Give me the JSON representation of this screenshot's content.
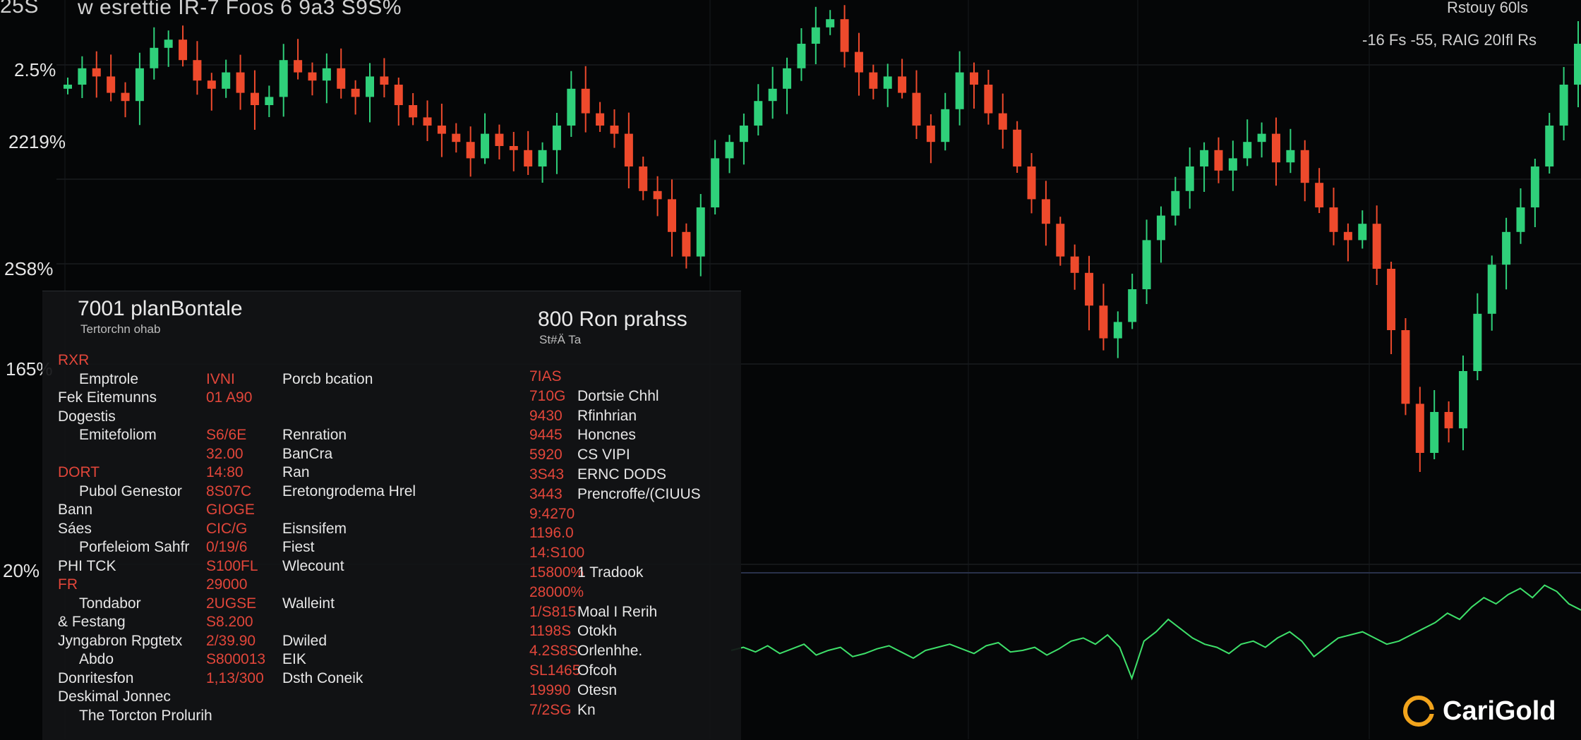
{
  "colors": {
    "up": "#2fd07a",
    "down": "#ee4a2c",
    "panel": "#121416",
    "logo_accent": "#f2a41c"
  },
  "header": {
    "top_left": "25S",
    "title": "w esrettie IR-7 Foos 6 9a3 S9S%",
    "top_right_1": "Rstouy 60ls",
    "top_right_2": "-16 Fs -55, RAIG 20Ifl Rs"
  },
  "y_axis_labels": [
    "2.5%",
    "2219%",
    "2S8%",
    "165%",
    "20%"
  ],
  "chart_data": {
    "type": "candlestick",
    "title": "w esrettie IR-7 Foos 6 9a3 S9S%",
    "y_tick_labels": [
      "2.5%",
      "2219%",
      "2S8%",
      "165%",
      "20%"
    ],
    "close_series": [
      100,
      104,
      102,
      98,
      96,
      104,
      109,
      111,
      106,
      101,
      99,
      103,
      98,
      95,
      97,
      106,
      103,
      101,
      104,
      99,
      97,
      102,
      100,
      95,
      92,
      90,
      88,
      86,
      82,
      88,
      85,
      84,
      80,
      84,
      90,
      99,
      93,
      90,
      88,
      80,
      74,
      72,
      64,
      58,
      70,
      82,
      86,
      90,
      96,
      99,
      104,
      110,
      114,
      116,
      108,
      103,
      99,
      102,
      98,
      90,
      86,
      94,
      103,
      100,
      93,
      89,
      80,
      72,
      66,
      58,
      54,
      46,
      38,
      42,
      50,
      62,
      68,
      74,
      80,
      84,
      79,
      82,
      86,
      88,
      81,
      84,
      76,
      70,
      64,
      62,
      66,
      55,
      40,
      22,
      10,
      20,
      16,
      30,
      44,
      56,
      64,
      70,
      80,
      90,
      100,
      110
    ],
    "oscillator": [
      0,
      2,
      -1,
      3,
      -2,
      1,
      4,
      -3,
      0,
      2,
      -4,
      -2,
      1,
      3,
      -1,
      -5,
      0,
      2,
      4,
      1,
      -2,
      3,
      5,
      -1,
      0,
      2,
      -3,
      1,
      6,
      8,
      4,
      10,
      2,
      -18,
      6,
      12,
      20,
      14,
      8,
      4,
      2,
      -2,
      4,
      6,
      2,
      8,
      12,
      6,
      -4,
      2,
      8,
      10,
      12,
      8,
      4,
      6,
      10,
      14,
      18,
      24,
      20,
      28,
      34,
      30,
      36,
      40,
      34,
      42,
      38,
      30,
      26
    ]
  },
  "panel_left": {
    "title": "7001 planBontale",
    "subtitle": "Tertorchn ohab",
    "rows": [
      {
        "left": "RXR",
        "left_red": true,
        "mid": "",
        "right": ""
      },
      {
        "left": "Emptrole",
        "left_red": false,
        "mid": "IVNI",
        "right": "Porcb bcation"
      },
      {
        "left": "Fek Eitemunns",
        "left_red": false,
        "mid": "01 A90",
        "right": ""
      },
      {
        "left": "Dogestis",
        "left_red": false,
        "mid": "",
        "right": ""
      },
      {
        "left": "Emitefoliom",
        "left_red": false,
        "mid": "S6/6E",
        "right": "Renration"
      },
      {
        "left": "",
        "left_red": false,
        "mid": "32.00",
        "right": "BanCra"
      },
      {
        "left": "DORT",
        "left_red": true,
        "mid": "14:80",
        "right": "Ran"
      },
      {
        "left": "Pubol Genestor",
        "left_red": false,
        "mid": "8S07C",
        "right": "Eretongrodema Hrel"
      },
      {
        "left": "Bann",
        "left_red": false,
        "mid": "GIOGE",
        "right": ""
      },
      {
        "left": "Sáes",
        "left_red": false,
        "mid": "CIC/G",
        "right": "Eisnsifem"
      },
      {
        "left": "Porfeleiom Sahfr",
        "left_red": false,
        "mid": "0/19/6",
        "right": "Fiest"
      },
      {
        "left": "PHI TCK",
        "left_red": false,
        "mid": "S100FL",
        "right": "Wlecount"
      },
      {
        "left": "FR",
        "left_red": true,
        "mid": "29000",
        "right": ""
      },
      {
        "left": "Tondabor",
        "left_red": false,
        "mid": "2UGSE",
        "right": "Walleint"
      },
      {
        "left": "& Festang",
        "left_red": false,
        "mid": "S8.200",
        "right": ""
      },
      {
        "left": "Jyngabron Rpgtetx",
        "left_red": false,
        "mid": "2/39.90",
        "right": "Dwiled"
      },
      {
        "left": "Abdo",
        "left_red": false,
        "mid": "S800013",
        "right": "EIK"
      },
      {
        "left": "Donritesfon",
        "left_red": false,
        "mid": "1,13/300",
        "right": "Dsth Coneik"
      },
      {
        "left": "Deskimal Jonnec",
        "left_red": false,
        "mid": "",
        "right": ""
      },
      {
        "left": "The Torcton Prolurih",
        "left_red": false,
        "mid": "",
        "right": ""
      }
    ]
  },
  "panel_right": {
    "title": "800 Ron prahss",
    "subtitle": "St#Ä Ta",
    "rows": [
      {
        "num": "7IAS",
        "label": ""
      },
      {
        "num": "710G",
        "label": "Dortsie Chhl"
      },
      {
        "num": "9430",
        "label": "Rfinhrian"
      },
      {
        "num": "9445",
        "label": "Honcnes"
      },
      {
        "num": "5920",
        "label": "CS VIPI"
      },
      {
        "num": "3S43",
        "label": "ERNC DODS"
      },
      {
        "num": "3443",
        "label": "Prencroffe/(CIUUS"
      },
      {
        "num": "9:4270",
        "label": ""
      },
      {
        "num": "1196.0",
        "label": ""
      },
      {
        "num": "14:S100",
        "label": ""
      },
      {
        "num": "15800%",
        "label": "1 Tradook"
      },
      {
        "num": "28000%",
        "label": ""
      },
      {
        "num": "1/S815",
        "label": "Moal I Rerih"
      },
      {
        "num": "1198S",
        "label": "Otokh"
      },
      {
        "num": "4.2S8S",
        "label": "Orlenhhe."
      },
      {
        "num": "SL1465",
        "label": "Ofcoh"
      },
      {
        "num": "19990",
        "label": "Otesn"
      },
      {
        "num": "7/2SG",
        "label": "Kn"
      }
    ]
  },
  "brand": {
    "name": "CariGold",
    "icon": "cg-logo-icon"
  }
}
